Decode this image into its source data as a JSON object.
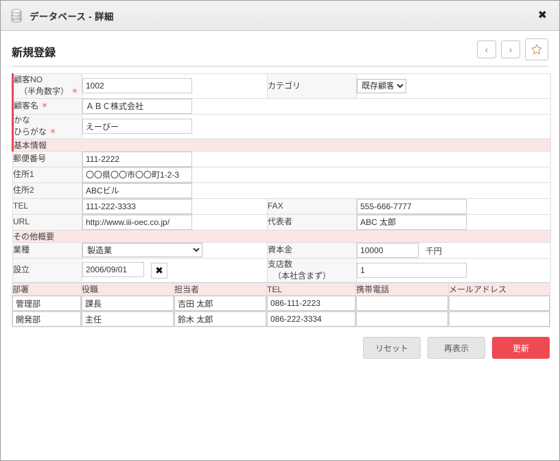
{
  "window": {
    "title": "データベース - 詳細",
    "icon": "database-icon",
    "close_label": "✖"
  },
  "header": {
    "page_title": "新規登録",
    "prev_label": "‹",
    "next_label": "›",
    "favorite_icon": "star-icon"
  },
  "colors": {
    "required_marker": "#e8465a",
    "section_header_bg": "#fbe6e6",
    "label_bg": "#f7f7f7",
    "primary_button": "#ef4a52",
    "nav_arrow": "#d07a28"
  },
  "form": {
    "customer_no": {
      "label": "顧客NO",
      "sublabel": "（半角数字）",
      "required_mark": "＊",
      "value": "1002"
    },
    "category": {
      "label": "カテゴリ",
      "selected": "既存顧客",
      "options": [
        "既存顧客"
      ]
    },
    "customer_name": {
      "label": "顧客名",
      "required_mark": "＊",
      "value": "ＡＢＣ株式会社"
    },
    "kana": {
      "label": "かな",
      "sublabel": "ひらがな",
      "required_mark": "＊",
      "value": "えーびー"
    },
    "section_basic": "基本情報",
    "postal_code": {
      "label": "郵便番号",
      "value": "111-2222"
    },
    "address1": {
      "label": "住所1",
      "value": "〇〇県〇〇市〇〇町1-2-3"
    },
    "address2": {
      "label": "住所2",
      "value": "ABCビル"
    },
    "tel": {
      "label": "TEL",
      "value": "111-222-3333"
    },
    "fax": {
      "label": "FAX",
      "value": "555-666-7777"
    },
    "url": {
      "label": "URL",
      "value": "http://www.iii-oec.co.jp/"
    },
    "representative": {
      "label": "代表者",
      "value": "ABC 太郎"
    },
    "section_other": "その他概要",
    "industry": {
      "label": "業種",
      "selected": "製造業",
      "options": [
        "製造業"
      ]
    },
    "capital": {
      "label": "資本金",
      "value": "10000",
      "unit": "千円"
    },
    "founded": {
      "label": "設立",
      "value": "2006/09/01",
      "clear_label": "✖"
    },
    "branches": {
      "label": "支店数",
      "sublabel": "（本社含まず）",
      "value": "1"
    }
  },
  "contacts": {
    "columns": [
      "部署",
      "役職",
      "担当者",
      "TEL",
      "携帯電話",
      "メールアドレス"
    ],
    "rows": [
      {
        "department": "管理部",
        "position": "課長",
        "person": "吉田 太郎",
        "tel": "086-111-2223",
        "mobile": "",
        "email": ""
      },
      {
        "department": "開発部",
        "position": "主任",
        "person": "鈴木 太郎",
        "tel": "086-222-3334",
        "mobile": "",
        "email": ""
      }
    ]
  },
  "footer": {
    "reset_label": "リセット",
    "reload_label": "再表示",
    "update_label": "更新"
  }
}
